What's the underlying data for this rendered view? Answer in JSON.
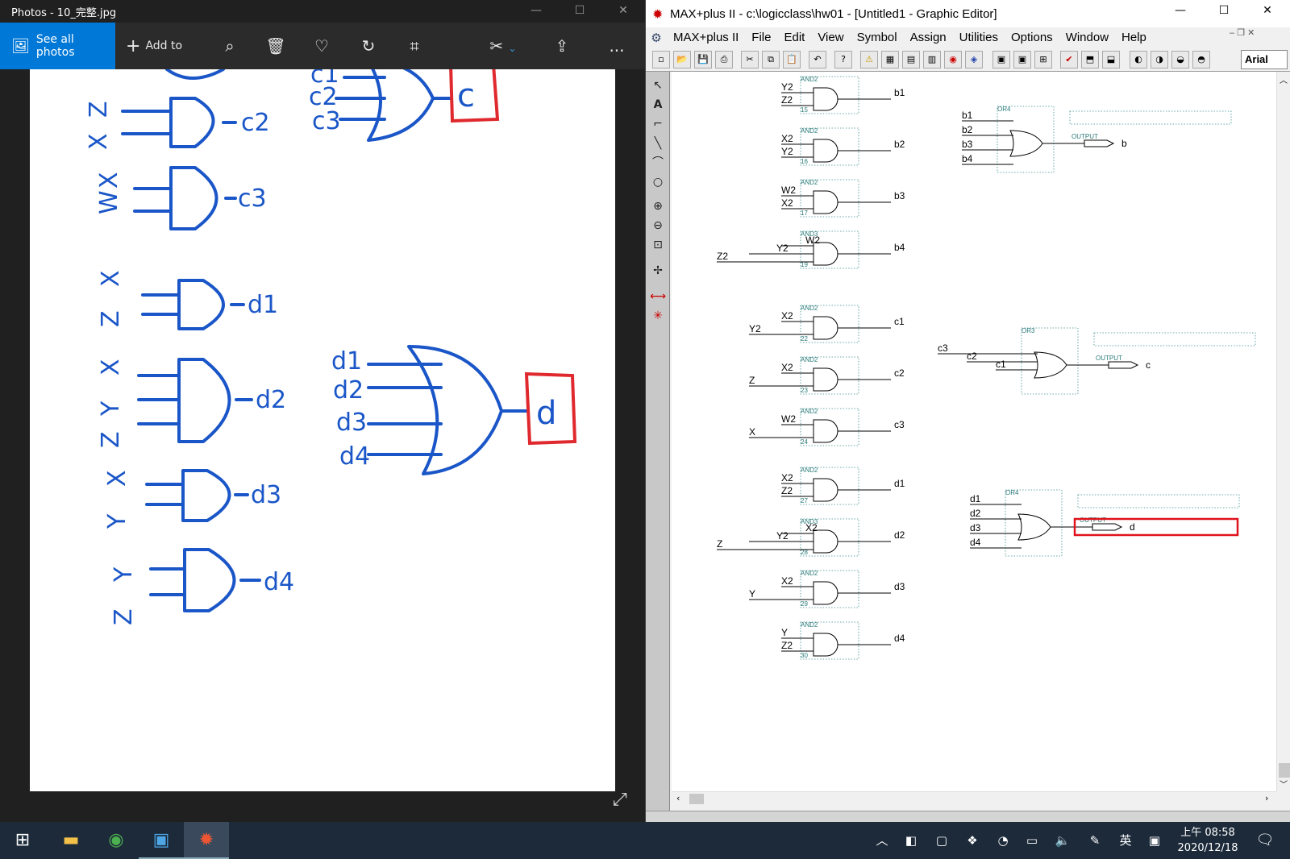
{
  "photos": {
    "title": "Photos - 10_完整.jpg",
    "see_all": "See all photos",
    "add_to": "Add to",
    "more": "...",
    "hw_left_vars": [
      "X",
      "Z",
      "W",
      "X",
      "X",
      "Z",
      "X",
      "Y",
      "Z",
      "X",
      "Y",
      "Y",
      "Z"
    ],
    "hw_gate_labels": [
      "c2",
      "c3",
      "d1",
      "d2",
      "d3",
      "d4"
    ],
    "hw_c_inputs": [
      "c1",
      "c2",
      "c3"
    ],
    "hw_c_output": "c",
    "hw_d_inputs": [
      "d1",
      "d2",
      "d3",
      "d4"
    ],
    "hw_d_output": "d",
    "colors": {
      "ink": "#1a56c8",
      "box": "#e0292e"
    }
  },
  "maxplus": {
    "title": "MAX+plus II - c:\\logicclass\\hw01 - [Untitled1 - Graphic Editor]",
    "menu": [
      "MAX+plus II",
      "File",
      "Edit",
      "View",
      "Symbol",
      "Assign",
      "Utilities",
      "Options",
      "Window",
      "Help"
    ],
    "font": "Arial",
    "gates": [
      {
        "type": "AND2",
        "inputs": [
          "Y2",
          "Z2"
        ],
        "output": "b1",
        "num": "15"
      },
      {
        "type": "AND2",
        "inputs": [
          "X2",
          "Y2"
        ],
        "output": "b2",
        "num": "16"
      },
      {
        "type": "AND2",
        "inputs": [
          "W2",
          "X2"
        ],
        "output": "b3",
        "num": "17"
      },
      {
        "type": "AND3",
        "inputs": [
          "W2",
          "Y2",
          "Z2"
        ],
        "output": "b4",
        "num": "19"
      },
      {
        "type": "AND2",
        "inputs": [
          "X2",
          "Y2"
        ],
        "output": "c1",
        "num": "22"
      },
      {
        "type": "AND2",
        "inputs": [
          "X2",
          "Z"
        ],
        "output": "c2",
        "num": "23"
      },
      {
        "type": "AND2",
        "inputs": [
          "W2",
          "X"
        ],
        "output": "c3",
        "num": "24"
      },
      {
        "type": "AND2",
        "inputs": [
          "X2",
          "Z2"
        ],
        "output": "d1",
        "num": "27"
      },
      {
        "type": "AND3",
        "inputs": [
          "X2",
          "Y2",
          "Z"
        ],
        "output": "d2",
        "num": "28"
      },
      {
        "type": "AND2",
        "inputs": [
          "X2",
          "Y"
        ],
        "output": "d3",
        "num": "29"
      },
      {
        "type": "AND2",
        "inputs": [
          "Y",
          "Z2"
        ],
        "output": "d4",
        "num": "30"
      }
    ],
    "or_gates": [
      {
        "type": "OR4",
        "inputs": [
          "b1",
          "b2",
          "b3",
          "b4"
        ],
        "output": "b",
        "out_type": "OUTPUT"
      },
      {
        "type": "OR3",
        "inputs": [
          "c3",
          "c2",
          "c1"
        ],
        "output": "c",
        "out_type": "OUTPUT"
      },
      {
        "type": "OR4",
        "inputs": [
          "d1",
          "d2",
          "d3",
          "d4"
        ],
        "output": "d",
        "out_type": "OUTPUT"
      }
    ],
    "highlight_color": "#e0121b"
  },
  "taskbar": {
    "time": "上午 08:58",
    "date": "2020/12/18",
    "lang": "英"
  }
}
